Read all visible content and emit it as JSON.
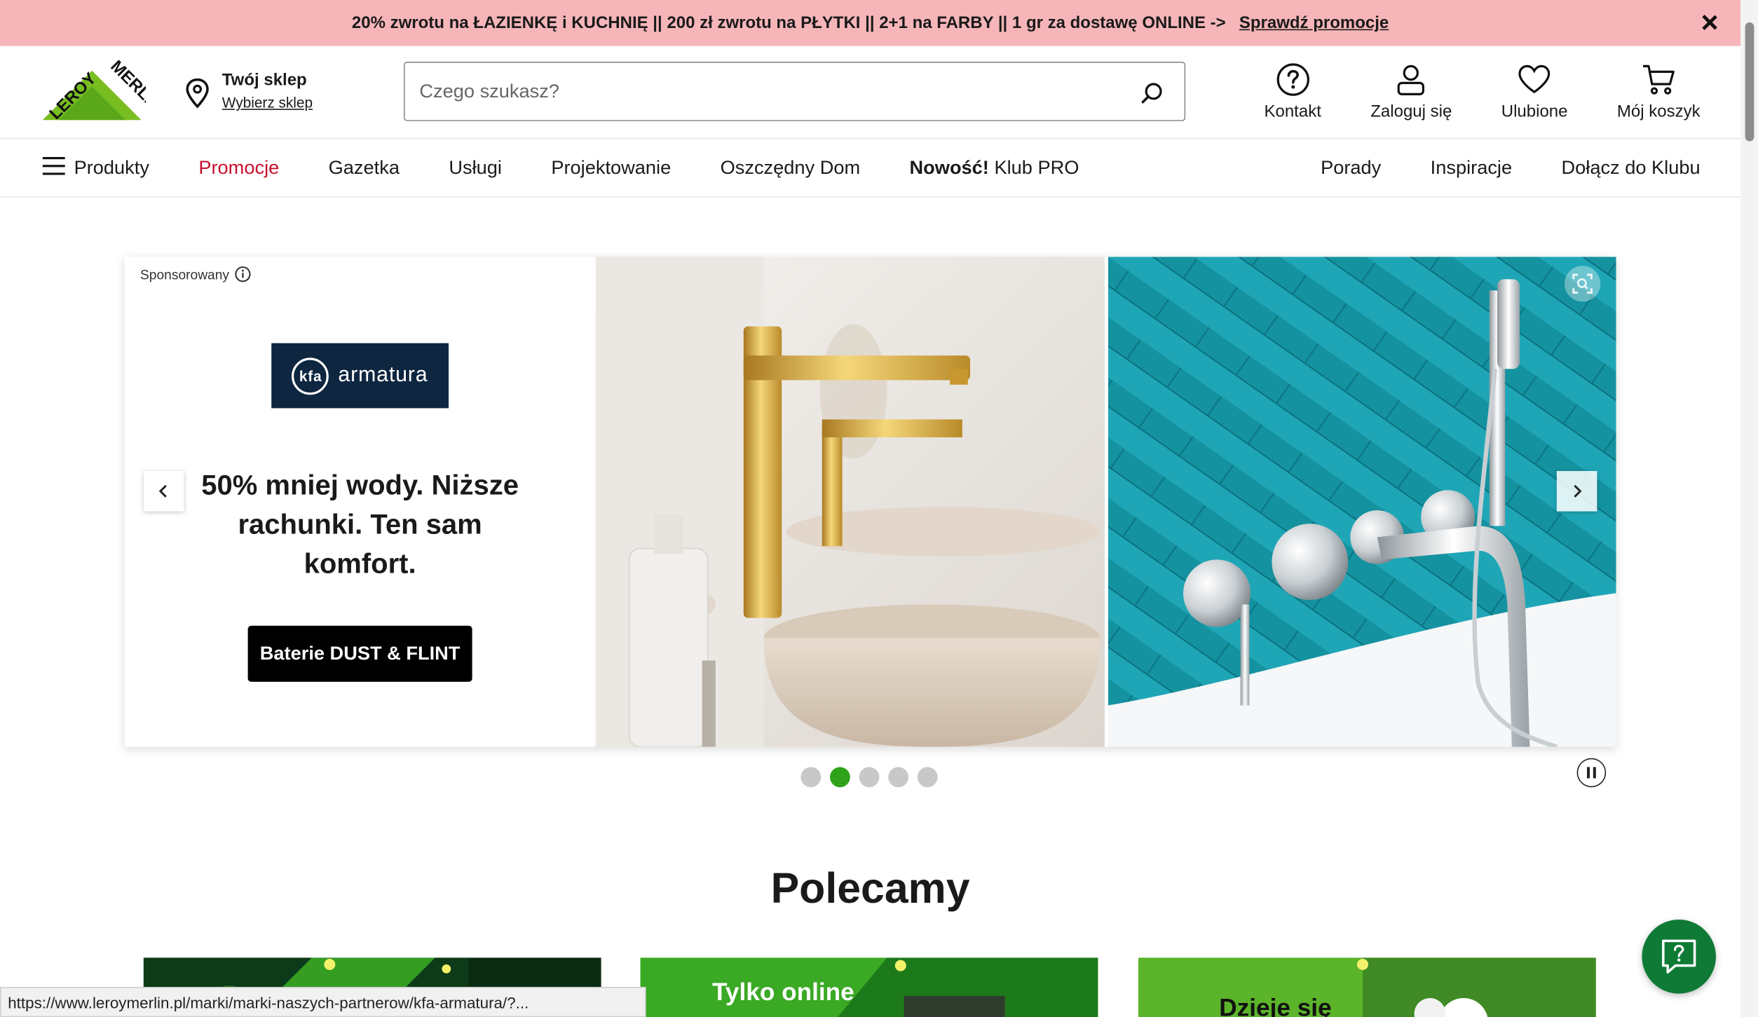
{
  "promo_bar": {
    "text": "20% zwrotu na ŁAZIENKĘ i KUCHNIĘ || 200 zł zwrotu na PŁYTKI || 2+1 na FARBY || 1 gr za dostawę ONLINE ->",
    "link": "Sprawdź promocje"
  },
  "header": {
    "logo_text": "LEROY MERLIN",
    "store_title": "Twój sklep",
    "store_link": "Wybierz sklep",
    "search_placeholder": "Czego szukasz?",
    "actions": [
      "Kontakt",
      "Zaloguj się",
      "Ulubione",
      "Mój koszyk"
    ]
  },
  "nav": {
    "left": [
      "Produkty",
      "Promocje",
      "Gazetka",
      "Usługi",
      "Projektowanie",
      "Oszczędny Dom"
    ],
    "pro_bold": "Nowość!",
    "pro_rest": "Klub PRO",
    "right": [
      "Porady",
      "Inspiracje",
      "Dołącz do Klubu"
    ]
  },
  "carousel": {
    "sponsored": "Sponsorowany",
    "brand": "armatura",
    "brand_mark": "kfa",
    "headline": "50% mniej wody. Niższe rachunki. Ten sam komfort.",
    "cta": "Baterie DUST & FLINT",
    "active_dot": 2,
    "dot_count": 5
  },
  "recommended": {
    "title": "Polecamy",
    "cards": [
      "",
      "Tylko online",
      "Dzieje się"
    ]
  },
  "status_url": "https://www.leroymerlin.pl/marki/marki-naszych-partnerow/kfa-armatura/?...",
  "colors": {
    "promo_bg": "#f6b6b9",
    "brand_green": "#2fa31a",
    "promo_red": "#c8102e",
    "chat_green": "#0f7a36"
  }
}
